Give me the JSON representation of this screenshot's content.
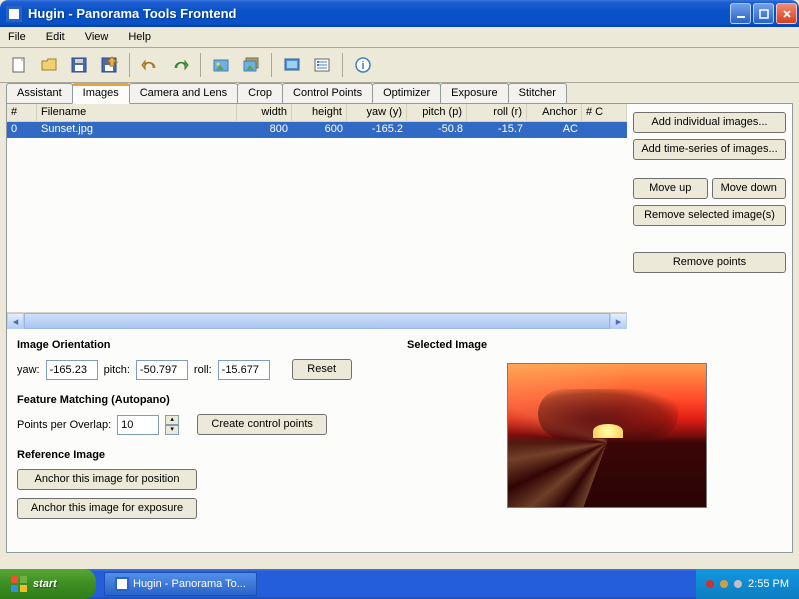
{
  "window": {
    "title": "Hugin - Panorama Tools Frontend"
  },
  "menubar": {
    "file": "File",
    "edit": "Edit",
    "view": "View",
    "help": "Help"
  },
  "tabs": {
    "assistant": "Assistant",
    "images": "Images",
    "camera_lens": "Camera and Lens",
    "crop": "Crop",
    "control_points": "Control Points",
    "optimizer": "Optimizer",
    "exposure": "Exposure",
    "stitcher": "Stitcher",
    "active": "images"
  },
  "table": {
    "columns": {
      "num": "#",
      "filename": "Filename",
      "width": "width",
      "height": "height",
      "yaw": "yaw (y)",
      "pitch": "pitch (p)",
      "roll": "roll (r)",
      "anchor": "Anchor",
      "numc": "# C"
    },
    "rows": [
      {
        "num": "0",
        "filename": "Sunset.jpg",
        "width": "800",
        "height": "600",
        "yaw": "-165.2",
        "pitch": "-50.8",
        "roll": "-15.7",
        "anchor": "AC"
      }
    ]
  },
  "sidebuttons": {
    "add_individual": "Add individual images...",
    "add_timeseries": "Add time-series of images...",
    "move_up": "Move up",
    "move_down": "Move down",
    "remove_selected": "Remove selected image(s)",
    "remove_points": "Remove points"
  },
  "orientation": {
    "heading": "Image Orientation",
    "yaw_label": "yaw:",
    "yaw_value": "-165.23",
    "pitch_label": "pitch:",
    "pitch_value": "-50.797",
    "roll_label": "roll:",
    "roll_value": "-15.677",
    "reset": "Reset"
  },
  "feature_matching": {
    "heading": "Feature Matching (Autopano)",
    "points_label": "Points per Overlap:",
    "points_value": "10",
    "create": "Create control points"
  },
  "reference": {
    "heading": "Reference Image",
    "anchor_position": "Anchor this image for position",
    "anchor_exposure": "Anchor this image for exposure"
  },
  "selected_image": {
    "heading": "Selected Image"
  },
  "taskbar": {
    "start": "start",
    "app": "Hugin - Panorama To...",
    "clock": "2:55 PM"
  }
}
